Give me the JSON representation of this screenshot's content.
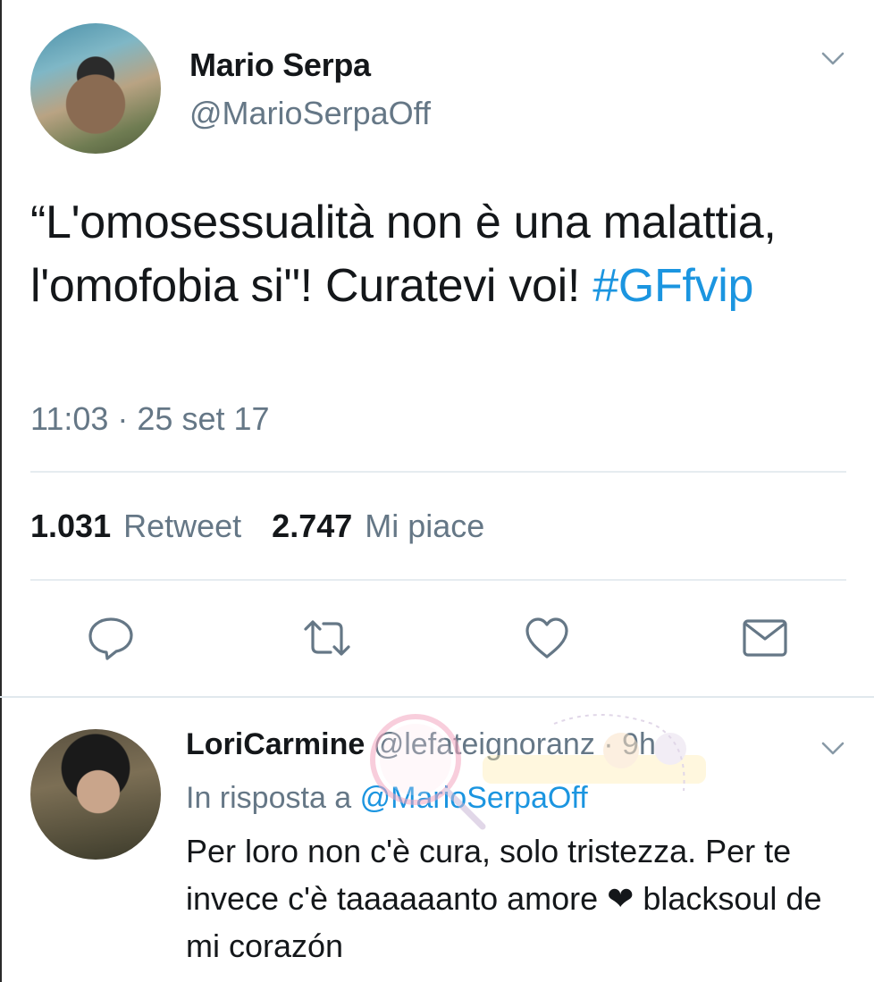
{
  "tweet": {
    "author_name": "Mario Serpa",
    "author_handle": "@MarioSerpaOff",
    "text_main": "“L'omosessualità non è una malattia, l'omofobia si\"! Curatevi voi! ",
    "hashtag": "#GFfvip",
    "timestamp": "11:03 · 25 set 17",
    "retweet_count": "1.031",
    "retweet_label": "Retweet",
    "like_count": "2.747",
    "like_label": "Mi piace"
  },
  "reply": {
    "author_name": "LoriCarmine",
    "author_handle": "@lefateignoranz · 9h",
    "in_reply_prefix": "In risposta a",
    "in_reply_mention": "@MarioSerpaOff",
    "text": "Per loro non c'è cura, solo tristezza. Per te invece c'è taaaaaanto amore ❤ blacksoul de mi corazón"
  },
  "icons": {
    "reply": "reply-icon",
    "retweet": "retweet-icon",
    "like": "heart-icon",
    "dm": "mail-icon",
    "menu": "chevron-down-icon"
  },
  "colors": {
    "text": "#14171a",
    "secondary": "#657786",
    "accent": "#1b95e0",
    "divider": "#e6ecf0"
  }
}
